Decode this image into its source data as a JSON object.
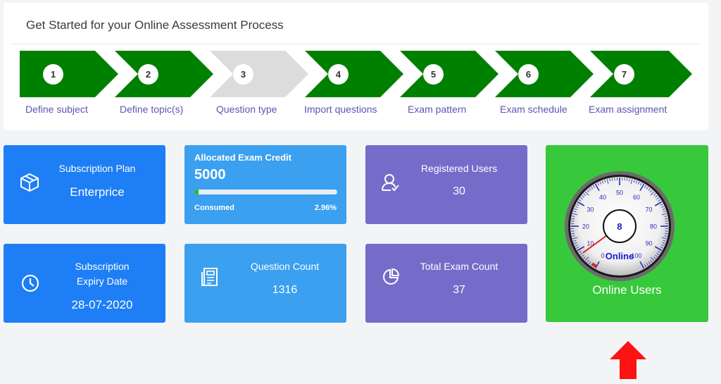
{
  "panel": {
    "title": "Get Started for your Online Assessment Process",
    "steps": [
      {
        "num": "1",
        "label": "Define subject",
        "state": "done"
      },
      {
        "num": "2",
        "label": "Define topic(s)",
        "state": "done"
      },
      {
        "num": "3",
        "label": "Question type",
        "state": "pending"
      },
      {
        "num": "4",
        "label": "Import questions",
        "state": "done"
      },
      {
        "num": "5",
        "label": "Exam pattern",
        "state": "done"
      },
      {
        "num": "6",
        "label": "Exam schedule",
        "state": "done"
      },
      {
        "num": "7",
        "label": "Exam assignment",
        "state": "done"
      }
    ]
  },
  "cards": {
    "subscription_plan": {
      "title": "Subscription Plan",
      "value": "Enterprice",
      "icon": "box-icon"
    },
    "exam_credit": {
      "title": "Allocated Exam Credit",
      "value": "5000",
      "consumed_label": "Consumed",
      "consumed_pct": "2.96%",
      "consumed_fraction": 0.0296
    },
    "registered_users": {
      "title": "Registered Users",
      "value": "30",
      "icon": "user-icon"
    },
    "expiry": {
      "title_line1": "Subscription",
      "title_line2": "Expiry Date",
      "value": "28-07-2020",
      "icon": "clock-icon"
    },
    "question_count": {
      "title": "Question Count",
      "value": "1316",
      "icon": "document-icon"
    },
    "total_exam_count": {
      "title": "Total Exam Count",
      "value": "37",
      "icon": "pie-chart-icon"
    },
    "online_users": {
      "label": "Online Users",
      "gauge_value": "8",
      "gauge_caption": "Online",
      "gauge_ticks": [
        "0",
        "10",
        "20",
        "30",
        "40",
        "50",
        "60",
        "70",
        "80",
        "90",
        "100"
      ],
      "needle_value": 8
    }
  },
  "colors": {
    "step_done": "#008000",
    "step_pending": "#dcdcdc",
    "card_blue": "#1e7ef5",
    "card_light_blue": "#3aa0ef",
    "card_purple": "#756bc9",
    "card_green": "#38c83b",
    "pointer_arrow": "#ff1212"
  }
}
